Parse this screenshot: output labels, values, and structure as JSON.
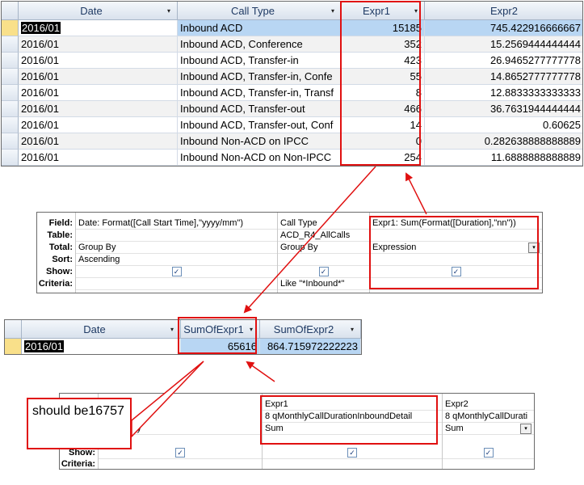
{
  "ds1": {
    "columns": [
      "Date",
      "Call Type",
      "Expr1",
      "Expr2"
    ],
    "rows": [
      {
        "date": "2016/01",
        "type": "Inbound ACD",
        "expr1": "15185",
        "expr2": "745.422916666667"
      },
      {
        "date": "2016/01",
        "type": "Inbound ACD, Conference",
        "expr1": "352",
        "expr2": "15.2569444444444"
      },
      {
        "date": "2016/01",
        "type": "Inbound ACD, Transfer-in",
        "expr1": "423",
        "expr2": "26.9465277777778"
      },
      {
        "date": "2016/01",
        "type": "Inbound ACD, Transfer-in, Confe",
        "expr1": "55",
        "expr2": "14.8652777777778"
      },
      {
        "date": "2016/01",
        "type": "Inbound ACD, Transfer-in, Transf",
        "expr1": "8",
        "expr2": "12.8833333333333"
      },
      {
        "date": "2016/01",
        "type": "Inbound ACD, Transfer-out",
        "expr1": "466",
        "expr2": "36.7631944444444"
      },
      {
        "date": "2016/01",
        "type": "Inbound ACD, Transfer-out, Conf",
        "expr1": "14",
        "expr2": "0.60625"
      },
      {
        "date": "2016/01",
        "type": "Inbound Non-ACD on IPCC",
        "expr1": "0",
        "expr2": "0.282638888888889"
      },
      {
        "date": "2016/01",
        "type": "Inbound Non-ACD on Non-IPCC",
        "expr1": "254",
        "expr2": "11.6888888888889"
      }
    ]
  },
  "qbe1": {
    "labels": [
      "Field:",
      "Table:",
      "Total:",
      "Sort:",
      "Show:",
      "Criteria:"
    ],
    "col1": {
      "field": "Date: Format([Call Start Time],\"yyyy/mm\")",
      "table": "",
      "total": "Group By",
      "sort": "Ascending",
      "criteria": ""
    },
    "col2": {
      "field": "Call Type",
      "table": "ACD_R4_AllCalls",
      "total": "Group By",
      "sort": "",
      "criteria": "Like \"*Inbound*\""
    },
    "col3": {
      "field": "Expr1: Sum(Format([Duration],\"nn\"))",
      "table": "",
      "total": "Expression",
      "sort": "",
      "criteria": ""
    }
  },
  "ds2": {
    "columns": [
      "Date",
      "SumOfExpr1",
      "SumOfExpr2"
    ],
    "row": {
      "date": "2016/01",
      "sum1": "65616",
      "sum2": "864.715972222223"
    }
  },
  "qbe2": {
    "labels": [
      "Show:",
      "Criteria:"
    ],
    "col1": {
      "total": "By"
    },
    "col2": {
      "field": "Expr1",
      "table": "8 qMonthlyCallDurationInboundDetail",
      "total": "Sum"
    },
    "col3": {
      "field": "Expr2",
      "table": "8 qMonthlyCallDurati",
      "total": "Sum"
    }
  },
  "note": {
    "text": "should be16757"
  },
  "icons": {
    "check": "✓",
    "dropdown": "▾"
  },
  "colors": {
    "annotation": "#e01010",
    "selected_row": "#b8d6f3",
    "header": "#d9e2ed"
  }
}
